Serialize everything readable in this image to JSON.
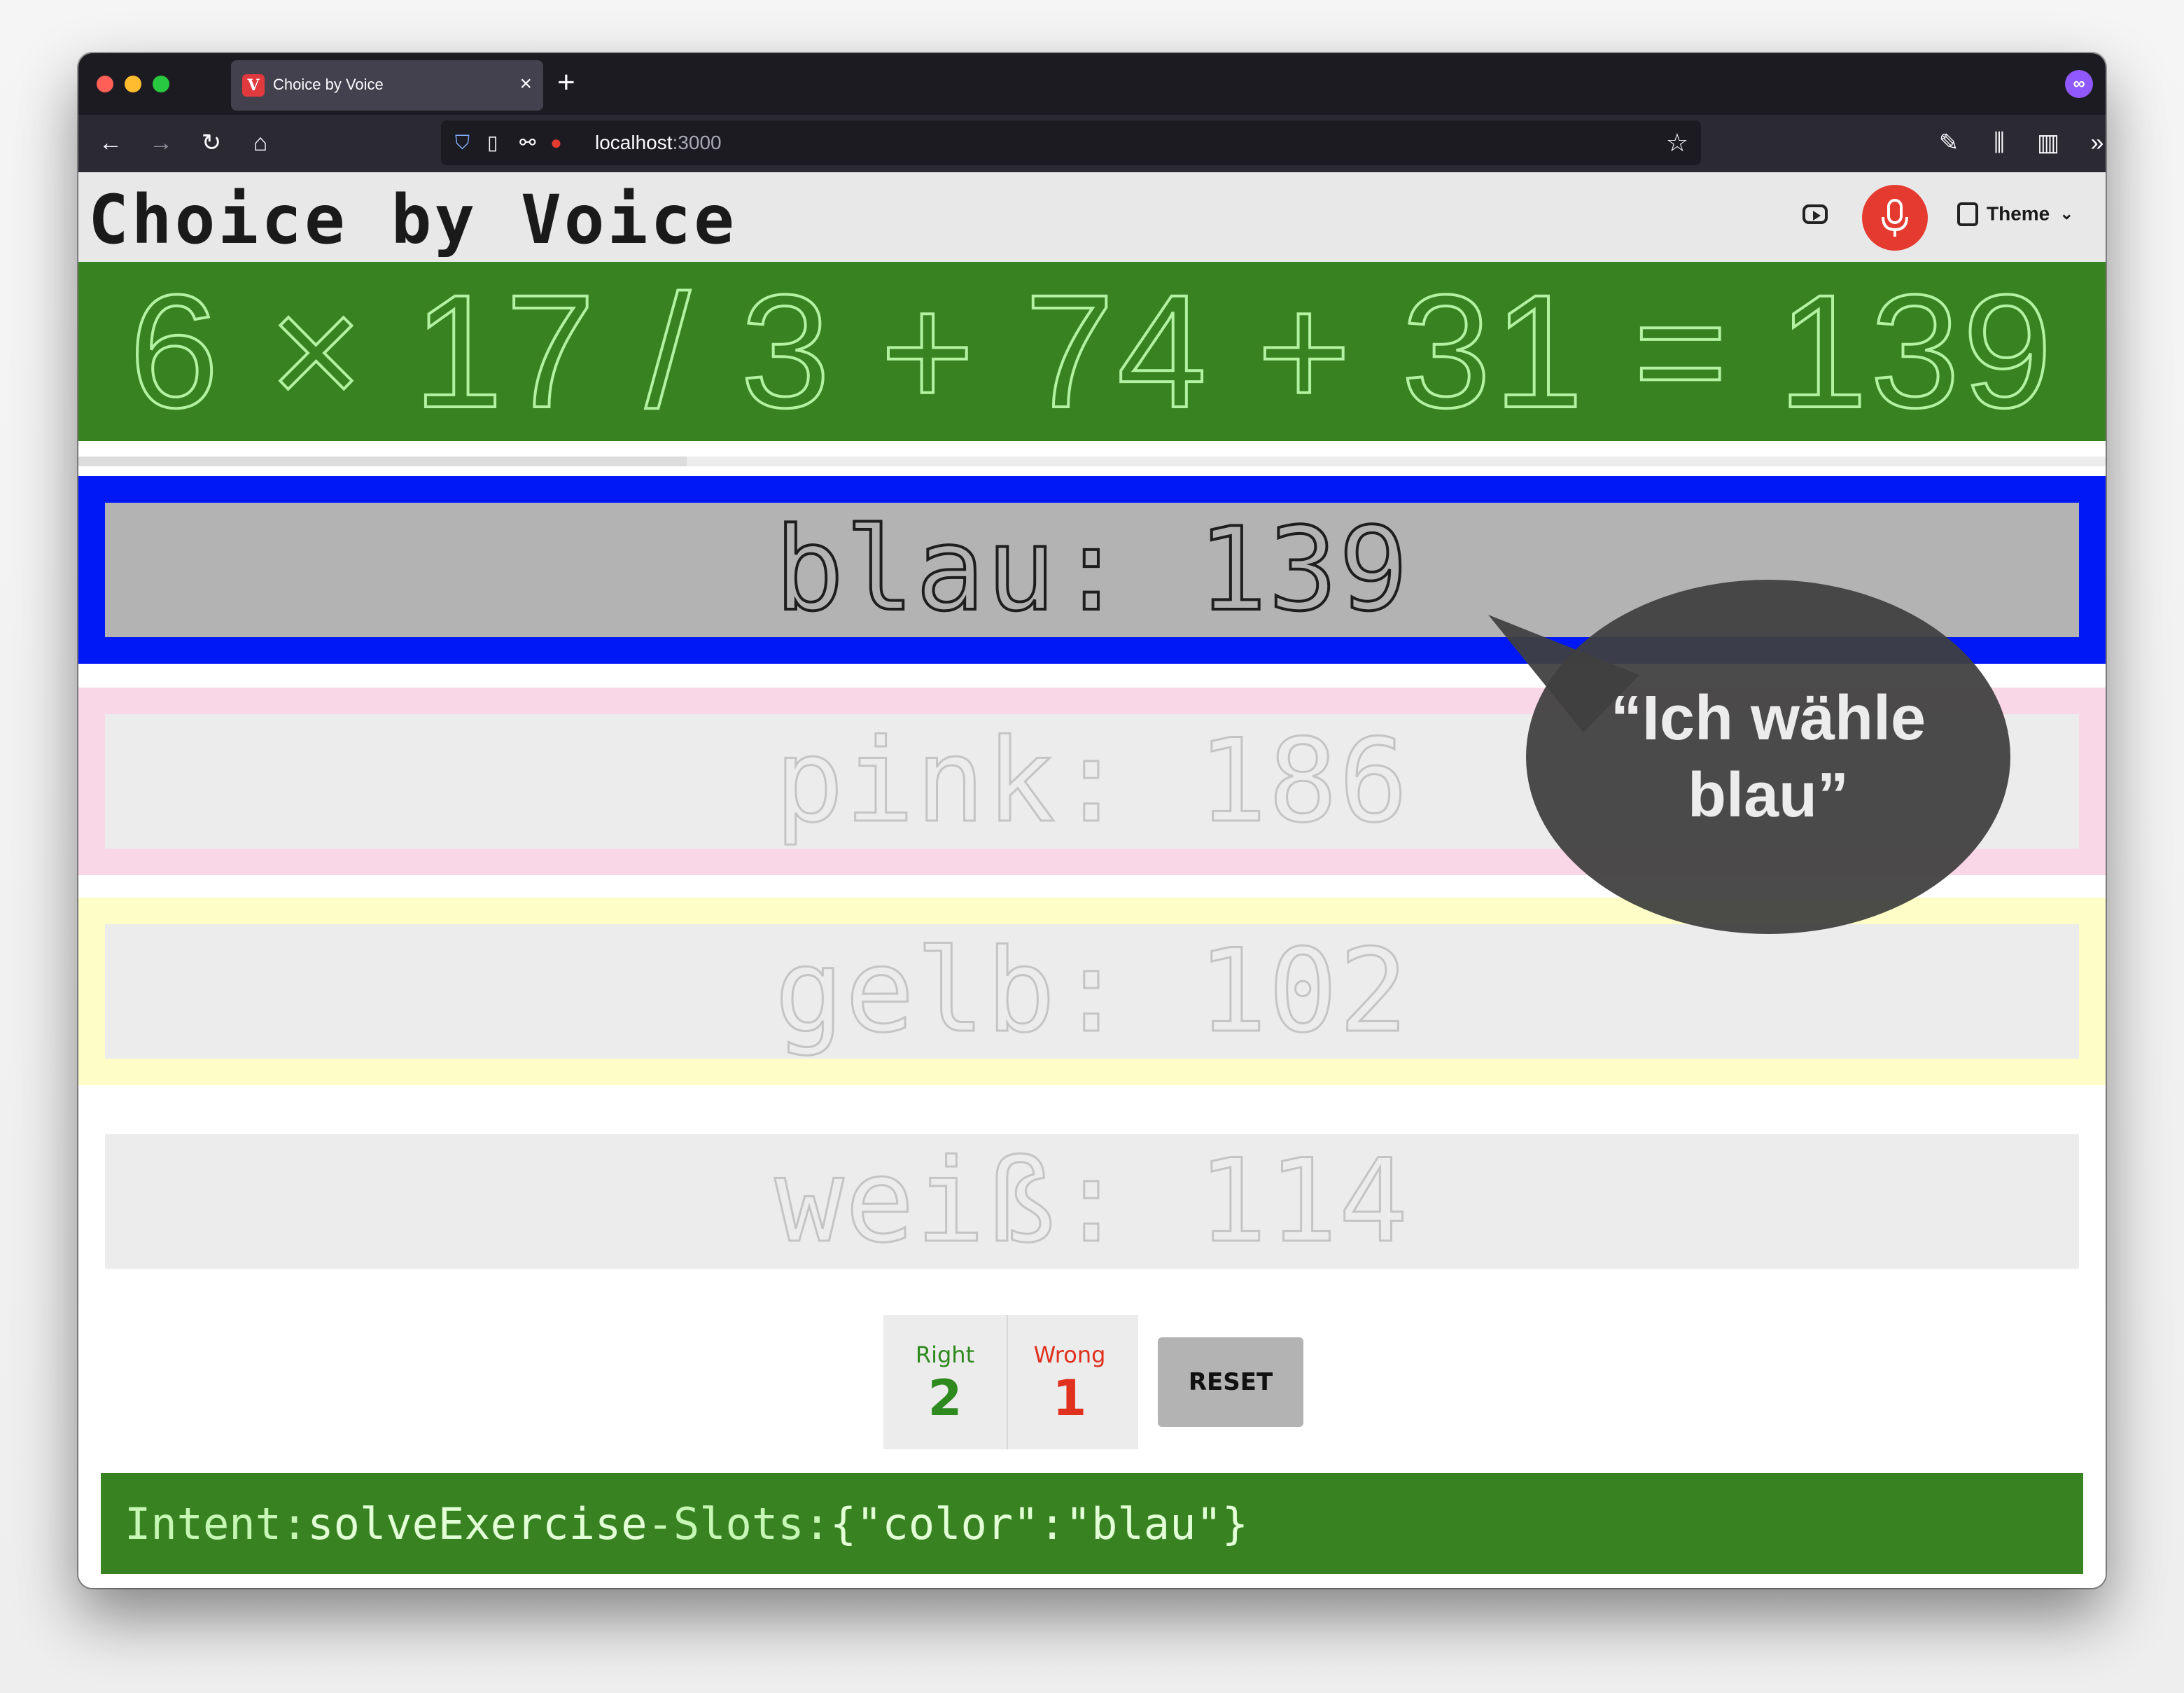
{
  "browser": {
    "tab_title": "Choice by Voice",
    "favicon_letter": "V",
    "url_host": "localhost",
    "url_port": ":3000"
  },
  "header": {
    "logo": "Choice by Voice",
    "theme_label": "Theme",
    "mic_active_color": "#e53a30"
  },
  "exercise": {
    "equation": "6 × 17 / 3 + 74 + 31 = 139",
    "time_remaining_fraction": 0.3
  },
  "options": [
    {
      "color_name": "blau",
      "value": "139",
      "label": "blau: 139",
      "border_color": "#0018f5",
      "selected": true
    },
    {
      "color_name": "pink",
      "value": "186",
      "label": "pink: 186",
      "border_color": "#f9d7e6",
      "selected": false
    },
    {
      "color_name": "gelb",
      "value": "102",
      "label": "gelb: 102",
      "border_color": "#fdfdc8",
      "selected": false
    },
    {
      "color_name": "weiß",
      "value": "114",
      "label": "weiß: 114",
      "border_color": "#ffffff",
      "selected": false
    }
  ],
  "speech_bubble": {
    "text": "“Ich wähle blau”"
  },
  "score": {
    "right_label": "Right",
    "right_value": "2",
    "wrong_label": "Wrong",
    "wrong_value": "1",
    "right_color": "#2e8a1e",
    "wrong_color": "#e0301e"
  },
  "reset_label": "RESET",
  "intent": {
    "intent_label": "Intent:",
    "intent_value": "solveExercise",
    "separator": "-",
    "slots_label": "Slots:",
    "slots_value": "{\"color\":\"blau\"}"
  }
}
